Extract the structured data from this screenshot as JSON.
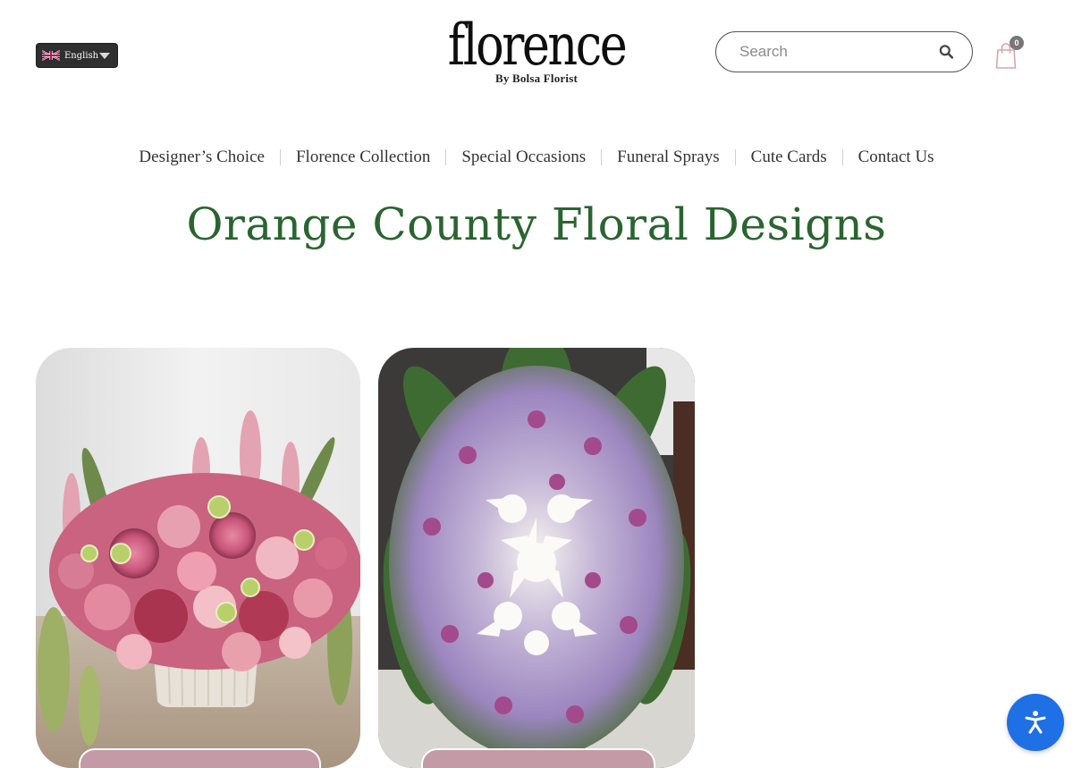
{
  "language": {
    "selected": "English",
    "flag_icon": "uk-flag-icon"
  },
  "logo": {
    "wordmark": "florence",
    "tagline": "By Bolsa Florist"
  },
  "search": {
    "placeholder": "Search",
    "icon": "search-icon"
  },
  "cart": {
    "count": "0",
    "icon": "shopping-bag-icon"
  },
  "nav": {
    "items": [
      {
        "label": "Designer’s Choice"
      },
      {
        "label": "Florence Collection"
      },
      {
        "label": "Special Occasions"
      },
      {
        "label": "Funeral Sprays"
      },
      {
        "label": "Cute Cards"
      },
      {
        "label": "Contact Us"
      }
    ]
  },
  "main": {
    "title": "Orange County Floral Designs"
  },
  "colors": {
    "title_green": "#2a6530",
    "accessibility_blue": "#1f6fe5",
    "card_button_pink": "#c39aa6"
  },
  "accessibility": {
    "icon": "accessibility-icon"
  }
}
